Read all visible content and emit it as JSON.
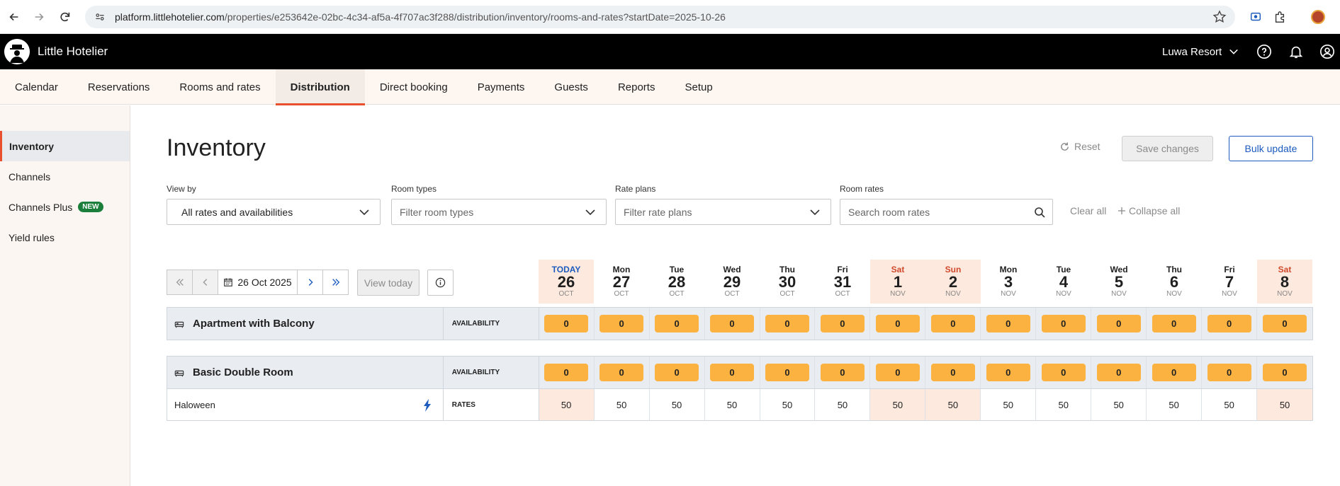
{
  "browser": {
    "url_host": "platform.littlehotelier.com",
    "url_path": "/properties/e253642e-02bc-4c34-af5a-4f707ac3f288/distribution/inventory/rooms-and-rates?startDate=2025-10-26"
  },
  "header": {
    "app_title": "Little Hotelier",
    "property": "Luwa Resort"
  },
  "tabs": [
    {
      "label": "Calendar"
    },
    {
      "label": "Reservations"
    },
    {
      "label": "Rooms and rates"
    },
    {
      "label": "Distribution",
      "active": true
    },
    {
      "label": "Direct booking"
    },
    {
      "label": "Payments"
    },
    {
      "label": "Guests"
    },
    {
      "label": "Reports"
    },
    {
      "label": "Setup"
    }
  ],
  "sidebar": {
    "items": [
      {
        "label": "Inventory",
        "active": true
      },
      {
        "label": "Channels"
      },
      {
        "label": "Channels Plus",
        "badge": "NEW"
      },
      {
        "label": "Yield rules"
      }
    ]
  },
  "page": {
    "title": "Inventory",
    "reset": "Reset",
    "save": "Save changes",
    "bulk": "Bulk update"
  },
  "filters": {
    "view_by_label": "View by",
    "view_by_value": "All rates and availabilities",
    "room_types_label": "Room types",
    "room_types_placeholder": "Filter room types",
    "rate_plans_label": "Rate plans",
    "rate_plans_placeholder": "Filter rate plans",
    "room_rates_label": "Room rates",
    "room_rates_placeholder": "Search room rates",
    "clear_all": "Clear all",
    "collapse_all": "Collapse all"
  },
  "date_nav": {
    "current": "26 Oct 2025",
    "view_today": "View today"
  },
  "days": [
    {
      "dow": "TODAY",
      "num": "26",
      "mon": "OCT",
      "kind": "today"
    },
    {
      "dow": "Mon",
      "num": "27",
      "mon": "OCT"
    },
    {
      "dow": "Tue",
      "num": "28",
      "mon": "OCT"
    },
    {
      "dow": "Wed",
      "num": "29",
      "mon": "OCT"
    },
    {
      "dow": "Thu",
      "num": "30",
      "mon": "OCT"
    },
    {
      "dow": "Fri",
      "num": "31",
      "mon": "OCT"
    },
    {
      "dow": "Sat",
      "num": "1",
      "mon": "NOV",
      "kind": "weekend"
    },
    {
      "dow": "Sun",
      "num": "2",
      "mon": "NOV",
      "kind": "weekend"
    },
    {
      "dow": "Mon",
      "num": "3",
      "mon": "NOV"
    },
    {
      "dow": "Tue",
      "num": "4",
      "mon": "NOV"
    },
    {
      "dow": "Wed",
      "num": "5",
      "mon": "NOV"
    },
    {
      "dow": "Thu",
      "num": "6",
      "mon": "NOV"
    },
    {
      "dow": "Fri",
      "num": "7",
      "mon": "NOV"
    },
    {
      "dow": "Sat",
      "num": "8",
      "mon": "NOV",
      "kind": "weekend"
    }
  ],
  "rooms": [
    {
      "name": "Apartment with Balcony",
      "type_label": "AVAILABILITY",
      "availability": [
        "0",
        "0",
        "0",
        "0",
        "0",
        "0",
        "0",
        "0",
        "0",
        "0",
        "0",
        "0",
        "0",
        "0"
      ],
      "rates": []
    },
    {
      "name": "Basic Double Room",
      "type_label": "AVAILABILITY",
      "availability": [
        "0",
        "0",
        "0",
        "0",
        "0",
        "0",
        "0",
        "0",
        "0",
        "0",
        "0",
        "0",
        "0",
        "0"
      ],
      "rates": [
        {
          "name": "Haloween",
          "type_label": "RATES",
          "values": [
            "50",
            "50",
            "50",
            "50",
            "50",
            "50",
            "50",
            "50",
            "50",
            "50",
            "50",
            "50",
            "50",
            "50"
          ]
        }
      ]
    }
  ],
  "colors": {
    "accent": "#e8502e",
    "primary": "#1d5bbf",
    "availability_pill": "#fbb240",
    "highlight_day": "#fde9dd"
  }
}
